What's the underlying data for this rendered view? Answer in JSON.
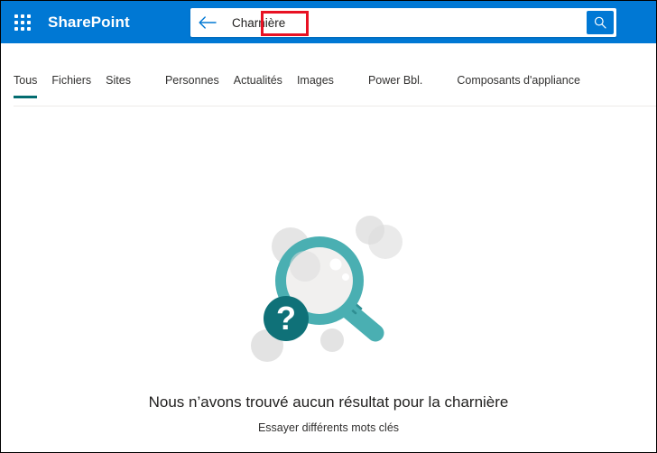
{
  "header": {
    "waffle_label": "app-launcher",
    "brand": "SharePoint",
    "background_color": "#0078d4"
  },
  "search": {
    "back_label": "back-arrow",
    "value": "Charnière",
    "placeholder": "Rechercher",
    "submit_label": "search-icon",
    "highlight_color": "#e81123"
  },
  "tabs": {
    "active_color": "#036c70",
    "items": [
      {
        "label": "Tous",
        "active": true
      },
      {
        "label": "Fichiers",
        "active": false
      },
      {
        "label": "Sites",
        "active": false
      },
      {
        "label": "Personnes",
        "active": false
      },
      {
        "label": "Actualités",
        "active": false
      },
      {
        "label": "Images",
        "active": false
      },
      {
        "label": "Power Bbl.",
        "active": false
      },
      {
        "label": "Composants d'appliance",
        "active": false
      }
    ]
  },
  "results": {
    "illustration": "magnifier-question-illustration",
    "title": "Nous n’avons trouvé aucun résultat pour la charnière",
    "subtitle": "Essayer différents mots clés",
    "colors": {
      "magnifier": "#4aafb2",
      "badge": "#0f7178",
      "bubble": "#dcdcdc",
      "lens": "#f1f0ef"
    }
  }
}
